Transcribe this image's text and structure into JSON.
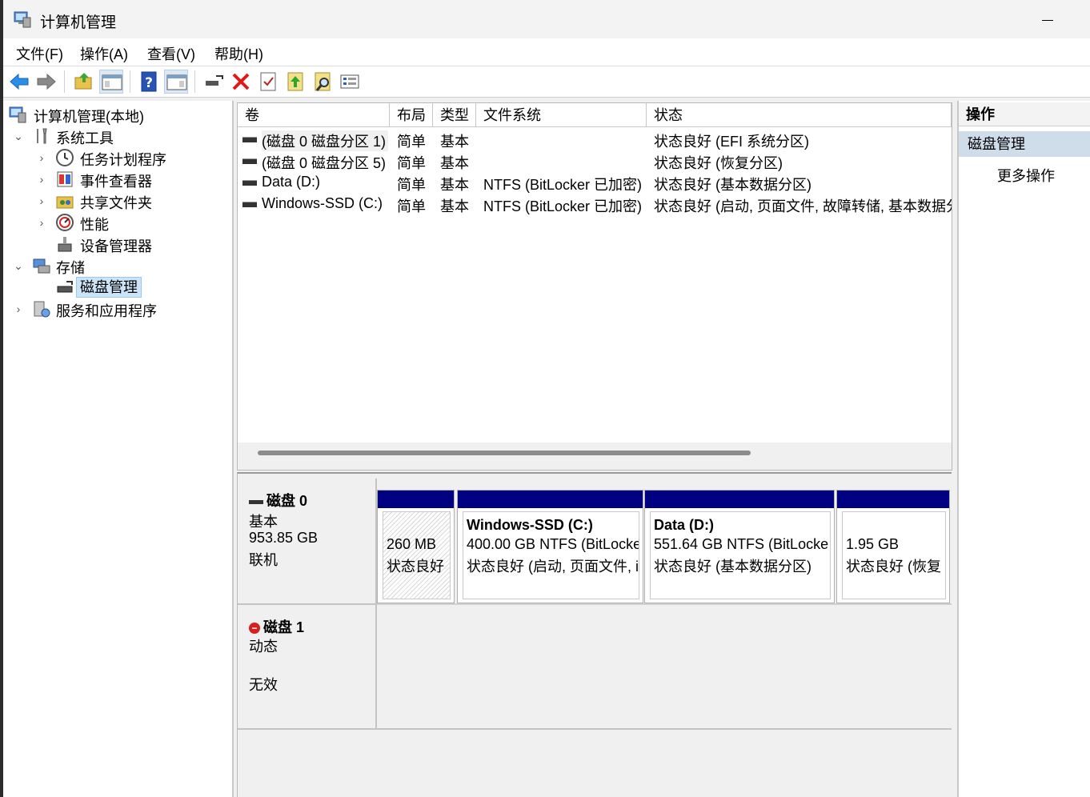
{
  "window": {
    "title": "计算机管理"
  },
  "menu": [
    "文件(F)",
    "操作(A)",
    "查看(V)",
    "帮助(H)"
  ],
  "toolbar": {
    "buttons": [
      "back-icon",
      "forward-icon",
      "up-folder-icon",
      "show-hide-tree-icon",
      "help-icon",
      "show-hide-action-icon",
      "connect-drive-icon",
      "delete-icon",
      "properties-icon",
      "up-arrow-icon",
      "search-icon",
      "settings-icon"
    ]
  },
  "tree": {
    "root": "计算机管理(本地)",
    "system_tools": "系统工具",
    "task_scheduler": "任务计划程序",
    "event_viewer": "事件查看器",
    "shared_folders": "共享文件夹",
    "performance": "性能",
    "device_manager": "设备管理器",
    "storage": "存储",
    "disk_management": "磁盘管理",
    "services_apps": "服务和应用程序"
  },
  "volume_list": {
    "columns": [
      "卷",
      "布局",
      "类型",
      "文件系统",
      "状态"
    ],
    "rows": [
      {
        "volume": "(磁盘 0 磁盘分区 1)",
        "layout": "简单",
        "type": "基本",
        "fs": "",
        "status": "状态良好 (EFI 系统分区)"
      },
      {
        "volume": "(磁盘 0 磁盘分区 5)",
        "layout": "简单",
        "type": "基本",
        "fs": "",
        "status": "状态良好 (恢复分区)"
      },
      {
        "volume": "Data (D:)",
        "layout": "简单",
        "type": "基本",
        "fs": "NTFS (BitLocker 已加密)",
        "status": "状态良好 (基本数据分区)"
      },
      {
        "volume": "Windows-SSD (C:)",
        "layout": "简单",
        "type": "基本",
        "fs": "NTFS (BitLocker 已加密)",
        "status": "状态良好 (启动, 页面文件, 故障转储, 基本数据分"
      }
    ]
  },
  "disks": [
    {
      "name": "磁盘 0",
      "type": "基本",
      "size": "953.85 GB",
      "state": "联机",
      "partitions": [
        {
          "line1": "",
          "line2": "260 MB",
          "line3": "状态良好"
        },
        {
          "line1": "Windows-SSD  (C:)",
          "line2": "400.00 GB NTFS (BitLocke",
          "line3": "状态良好 (启动, 页面文件, i"
        },
        {
          "line1": "Data  (D:)",
          "line2": "551.64 GB NTFS (BitLocke",
          "line3": "状态良好 (基本数据分区)"
        },
        {
          "line1": "",
          "line2": "1.95 GB",
          "line3": "状态良好 (恢复"
        }
      ]
    },
    {
      "name": "磁盘 1",
      "type": "动态",
      "size": "",
      "state": "无效"
    }
  ],
  "actions": {
    "header": "操作",
    "section": "磁盘管理",
    "more": "更多操作"
  },
  "colors": {
    "partition_bar": "#000080",
    "selection": "#cce4f7",
    "action_section": "#cfdcea"
  }
}
